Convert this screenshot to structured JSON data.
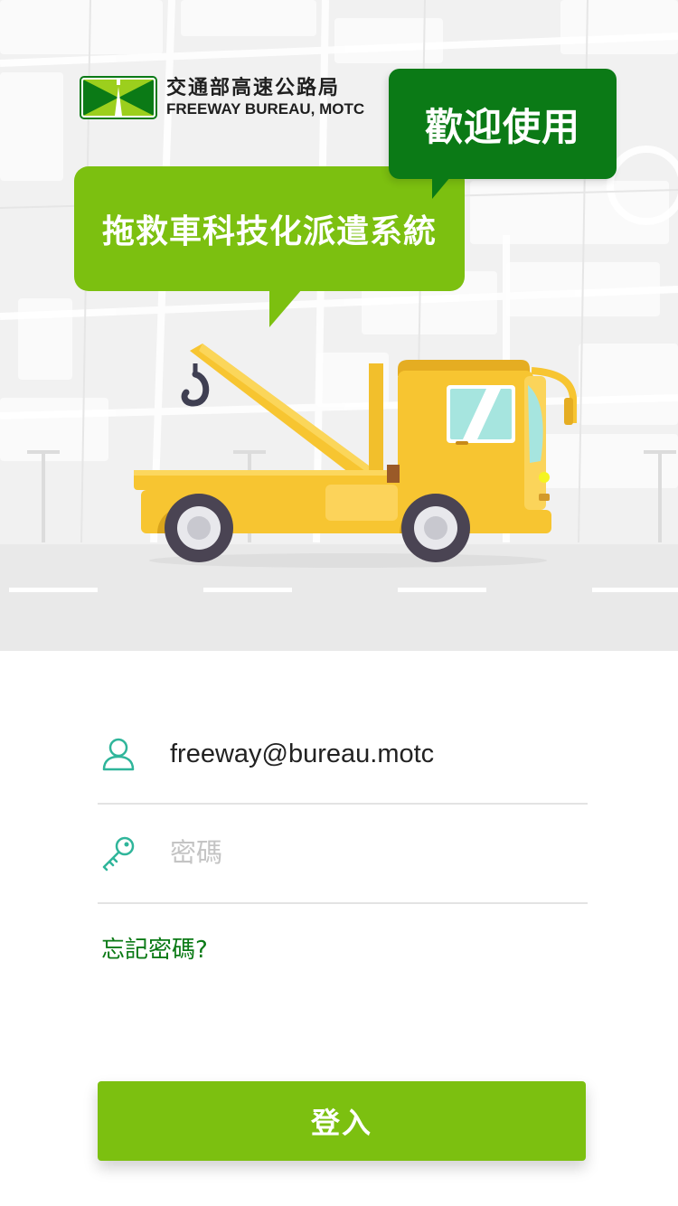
{
  "logo": {
    "name_zh": "交通部高速公路局",
    "name_en": "FREEWAY BUREAU, MOTC",
    "icon": "freeway-bureau-logo"
  },
  "hero": {
    "welcome": "歡迎使用",
    "system_name": "拖救車科技化派遣系統",
    "illustration": "tow-truck-icon"
  },
  "login_form": {
    "email": {
      "icon": "user-icon",
      "value": "freeway@bureau.motc"
    },
    "password": {
      "icon": "key-icon",
      "placeholder": "密碼"
    },
    "forgot_password": "忘記密碼?",
    "submit": "登入"
  },
  "colors": {
    "primary_green": "#7cc010",
    "dark_green": "#0b7a16",
    "icon_teal": "#2fb59a",
    "truck_yellow": "#f7c531"
  }
}
